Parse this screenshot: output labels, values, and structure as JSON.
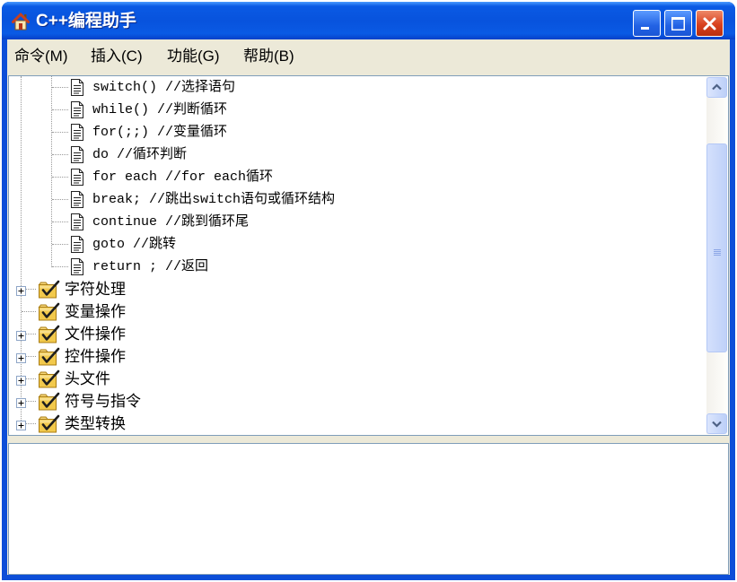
{
  "window": {
    "title": "C++编程助手",
    "icon": "house-icon"
  },
  "title_bar_buttons": [
    {
      "icon": "minimize-icon"
    },
    {
      "icon": "maximize-icon"
    },
    {
      "icon": "close-icon"
    }
  ],
  "menu": {
    "items": [
      {
        "label": "命令(M)"
      },
      {
        "label": "插入(C)"
      },
      {
        "label": "功能(G)"
      },
      {
        "label": "帮助(B)"
      }
    ]
  },
  "tree": {
    "child_icon": "document-icon",
    "root_icon": "checked-folder-icon",
    "expand_icon": "plus-box-icon",
    "children": [
      "switch() //选择语句",
      "while() //判断循环",
      "for(;;) //变量循环",
      "do //循环判断",
      "for each //for each循环",
      "break; //跳出switch语句或循环结构",
      "continue //跳到循环尾",
      "goto //跳转",
      "return ; //返回"
    ],
    "roots": [
      {
        "label": "字符处理",
        "expandable": true
      },
      {
        "label": "变量操作",
        "expandable": false
      },
      {
        "label": "文件操作",
        "expandable": true
      },
      {
        "label": "控件操作",
        "expandable": true
      },
      {
        "label": "头文件",
        "expandable": true
      },
      {
        "label": "符号与指令",
        "expandable": true
      },
      {
        "label": "类型转换",
        "expandable": true
      }
    ]
  },
  "scrollbar": {
    "up_icon": "chevron-up-icon",
    "down_icon": "chevron-down-icon",
    "grip_icon": "grip-icon"
  },
  "colors": {
    "title_bar": "#0A5AE4",
    "window_frame": "#0D4ED8",
    "menu_background": "#ECE9D8",
    "close_button": "#D9411E",
    "panel_border": "#7F9DB9"
  }
}
